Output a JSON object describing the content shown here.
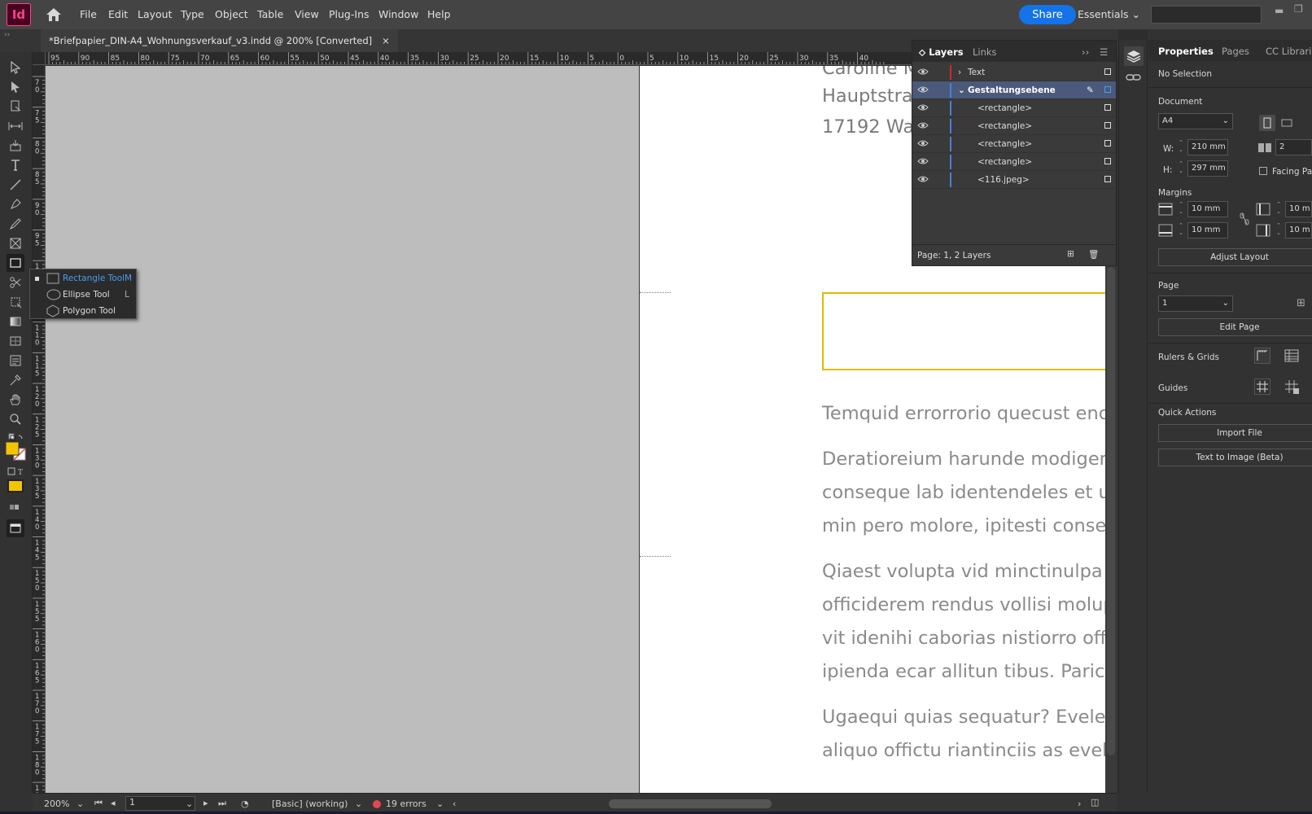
{
  "app": {
    "logo_text": "Id"
  },
  "menu": [
    "File",
    "Edit",
    "Layout",
    "Type",
    "Object",
    "Table",
    "View",
    "Plug-Ins",
    "Window",
    "Help"
  ],
  "header": {
    "share_label": "Share",
    "workspace_label": "Essentials"
  },
  "document": {
    "tab_title": "*Briefpapier_DIN-A4_Wohnungsverkauf_v3.indd @ 200% [Converted]",
    "close_glyph": "×"
  },
  "ruler_h_labels": [
    "95",
    "90",
    "85",
    "80",
    "75",
    "70",
    "65",
    "60",
    "55",
    "50",
    "45",
    "40",
    "35",
    "30",
    "25",
    "20",
    "15",
    "10",
    "5",
    "0",
    "5",
    "10",
    "15",
    "20",
    "25",
    "30",
    "35",
    "40"
  ],
  "ruler_v_labels": [
    "7 0",
    "7 5",
    "8 0",
    "8 5",
    "9 0",
    "9 5",
    "1 0 0",
    "1 0 5",
    "1 1 0",
    "1 1 5",
    "1 2 0",
    "1 2 5",
    "1 3 0",
    "1 3 5",
    "1 4 0",
    "1 4 5",
    "1 5 0",
    "1 5 5",
    "1 6 0",
    "1 6 5",
    "1 7 0",
    "1 7 5",
    "1 8 0",
    "1 8"
  ],
  "page_content": {
    "address": [
      "Caroline M",
      "Hauptstra",
      "17192 War"
    ],
    "paragraphs": [
      [
        "Temquid errorrorio quecust enc"
      ],
      [
        "Deratioreium harunde modigen",
        "conseque lab identendeles et ut",
        "min pero molore, ipitesti consec"
      ],
      [
        "Qiaest volupta vid minctinulpa i",
        "officiderem rendus vollisi molup",
        "vit idenihi caborias nistiorro offi",
        "ipienda ecar allitun tibus. Parico"
      ],
      [
        "Ugaequi quias sequatur? Evelen",
        "aliquo offictu riantinciis as eveli"
      ]
    ]
  },
  "flyout": {
    "items": [
      {
        "label": "Rectangle Tool",
        "key": "M"
      },
      {
        "label": "Ellipse Tool",
        "key": "L"
      },
      {
        "label": "Polygon Tool",
        "key": ""
      }
    ]
  },
  "layers_panel": {
    "tabs": [
      "Layers",
      "Links"
    ],
    "rows": [
      {
        "name": "Text"
      },
      {
        "name": "Gestaltungsebene"
      },
      {
        "name": "<rectangle>"
      },
      {
        "name": "<rectangle>"
      },
      {
        "name": "<rectangle>"
      },
      {
        "name": "<rectangle>"
      },
      {
        "name": "<116.jpeg>"
      }
    ],
    "footer": "Page: 1, 2 Layers"
  },
  "properties": {
    "tabs": [
      "Properties",
      "Pages",
      "CC Libraries"
    ],
    "selection": "No Selection",
    "document_label": "Document",
    "preset": "A4",
    "width_label": "W:",
    "width": "210 mm",
    "height_label": "H:",
    "height": "297 mm",
    "pages_value": "2",
    "facing_pages": "Facing Pag",
    "margins_label": "Margins",
    "margin_top": "10 mm",
    "margin_bottom": "10 mm",
    "margin_left": "10 m",
    "margin_right": "10 m",
    "adjust_layout": "Adjust Layout",
    "page_label": "Page",
    "page_value": "1",
    "edit_page": "Edit Page",
    "rulers_grids": "Rulers & Grids",
    "guides": "Guides",
    "quick_actions": "Quick Actions",
    "import_file": "Import File",
    "text_to_image": "Text to Image (Beta)"
  },
  "status": {
    "zoom": "200%",
    "page": "1",
    "preflight_profile": "[Basic] (working)",
    "errors": "19 errors"
  },
  "colors": {
    "accent": "#1473e6",
    "fill_swatch": "#f2c500",
    "frame_stroke": "#e6b800",
    "gestaltung_layer": "#4a7fd8",
    "text_layer": "#d9262b"
  }
}
